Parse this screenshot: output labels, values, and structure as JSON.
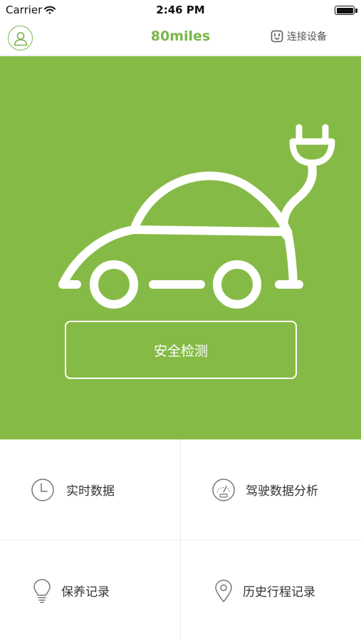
{
  "status_bar": {
    "carrier": "Carrier",
    "time": "2:46 PM",
    "battery_level": 1.0
  },
  "nav": {
    "title": "80miles",
    "connect_label": "连接设备",
    "avatar_icon": "user-icon",
    "connect_icon": "socket-icon"
  },
  "hero": {
    "safety_check_label": "安全检测",
    "illustration": "electric-car-with-plug",
    "background_color": "#86ba46"
  },
  "menu": [
    {
      "label": "实时数据",
      "icon": "clock-icon"
    },
    {
      "label": "驾驶数据分析",
      "icon": "speedometer-icon"
    },
    {
      "label": "保养记录",
      "icon": "lightbulb-icon"
    },
    {
      "label": "历史行程记录",
      "icon": "location-pin-icon"
    }
  ],
  "colors": {
    "accent": "#7ab648",
    "hero_green": "#86ba46"
  }
}
